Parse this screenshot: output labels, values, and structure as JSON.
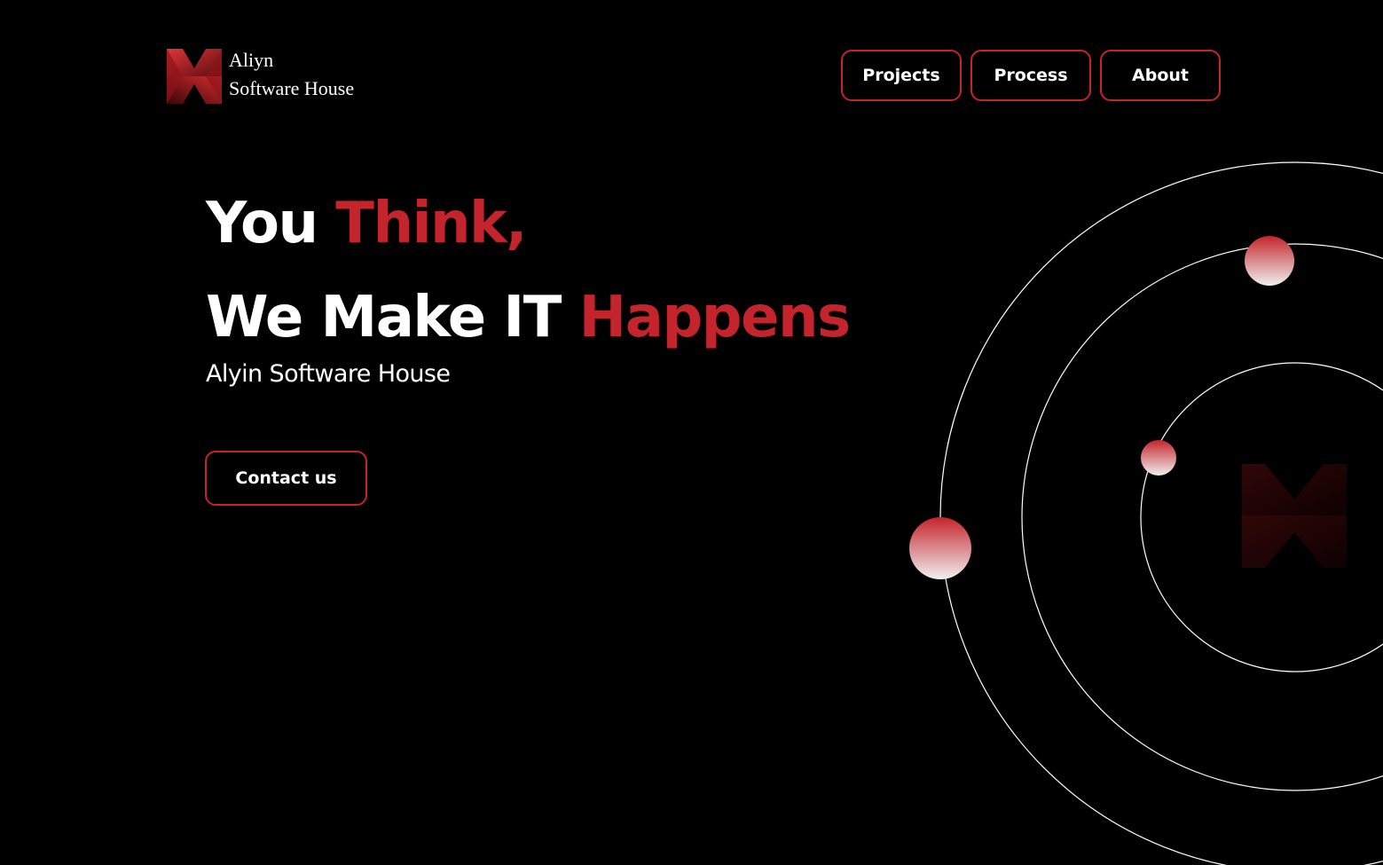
{
  "brand": {
    "line1": "Aliyn",
    "line2": "Software House",
    "logo_icon": "aliyn-logo-icon"
  },
  "nav": {
    "items": [
      {
        "label": "Projects"
      },
      {
        "label": "Process"
      },
      {
        "label": "About"
      }
    ]
  },
  "hero": {
    "line1_white": "You",
    "line1_accent": "Think,",
    "line2_white": "We Make IT",
    "line2_accent": "Happens",
    "subtitle": "Alyin Software House"
  },
  "cta": {
    "label": "Contact us"
  },
  "colors": {
    "background": "#000000",
    "accent": "#c4242b",
    "text": "#ffffff",
    "orbit_line": "#ffffff"
  }
}
